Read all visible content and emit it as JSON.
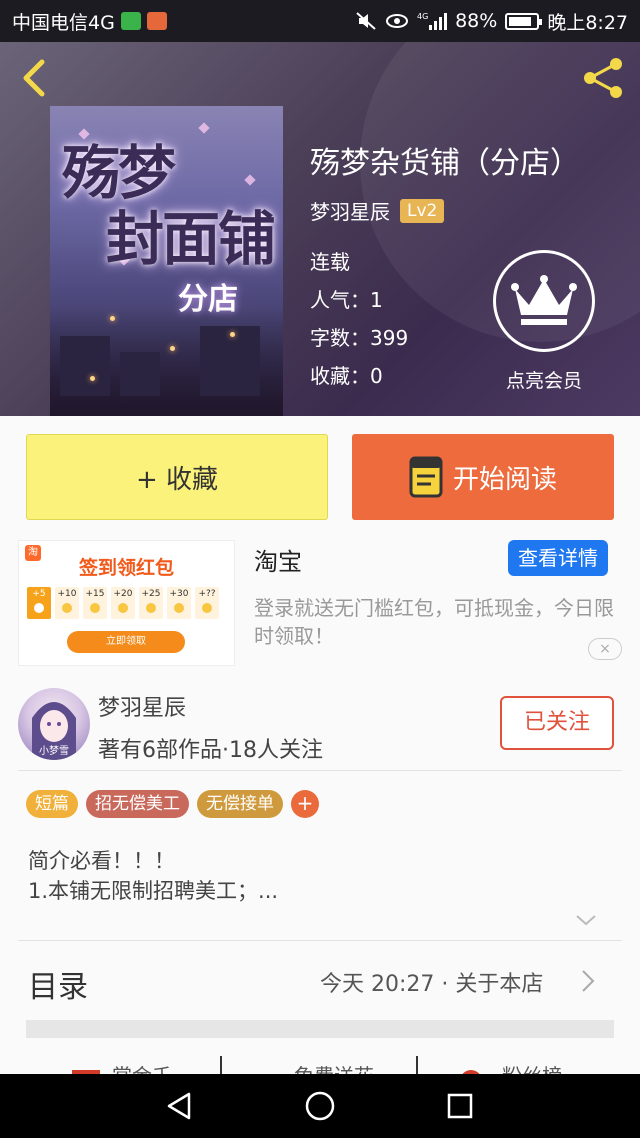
{
  "status_bar": {
    "carrier": "中国电信4G",
    "battery": "88%",
    "time": "晚上8:27",
    "network": "4G"
  },
  "book": {
    "title": "殇梦杂货铺（分店）",
    "author": "梦羽星辰",
    "level": "Lv2",
    "status": "连载",
    "popularity": "人气：1",
    "word_count": "字数：399",
    "favorites": "收藏：0",
    "cover_text_line1": "殇梦",
    "cover_text_line2": "封面铺",
    "cover_text_sub": "分店",
    "vip_label": "点亮会员"
  },
  "actions": {
    "collect_label": "+ 收藏",
    "read_label": "开始阅读"
  },
  "ad": {
    "title": "淘宝",
    "detail_button": "查看详情",
    "description": "登录就送无门槛红包，可抵现金，今日限时领取！",
    "banner_headline": "签到领红包",
    "banner_claim": "立即领取",
    "banner_logo": "淘",
    "banner_steps": [
      "+5",
      "+10",
      "+15",
      "+20",
      "+25",
      "+30",
      "+??"
    ],
    "close_icon": "×"
  },
  "author_card": {
    "name": "梦羽星辰",
    "stats": "著有6部作品·18人关注",
    "follow_label": "已关注",
    "avatar_text": "小梦雪"
  },
  "tags": [
    {
      "label": "短篇",
      "color": "#f0b03a"
    },
    {
      "label": "招无偿美工",
      "color": "#c9695c"
    },
    {
      "label": "无偿接单",
      "color": "#cf9a3e"
    }
  ],
  "tag_add_label": "+",
  "intro": {
    "line1": "简介必看！！！",
    "line2": "1.本铺无限制招聘美工；..."
  },
  "toc": {
    "label": "目录",
    "meta": "今天 20:27 · 关于本店"
  },
  "bottom_tabs": [
    "赏金千",
    "免费送花",
    "粉丝榜"
  ],
  "colors": {
    "accent_orange": "#ed6b3d",
    "collect_yellow": "#faf27a",
    "follow_red": "#e0523b",
    "ad_blue": "#1f78f0",
    "level_gold": "#e6b14a"
  }
}
